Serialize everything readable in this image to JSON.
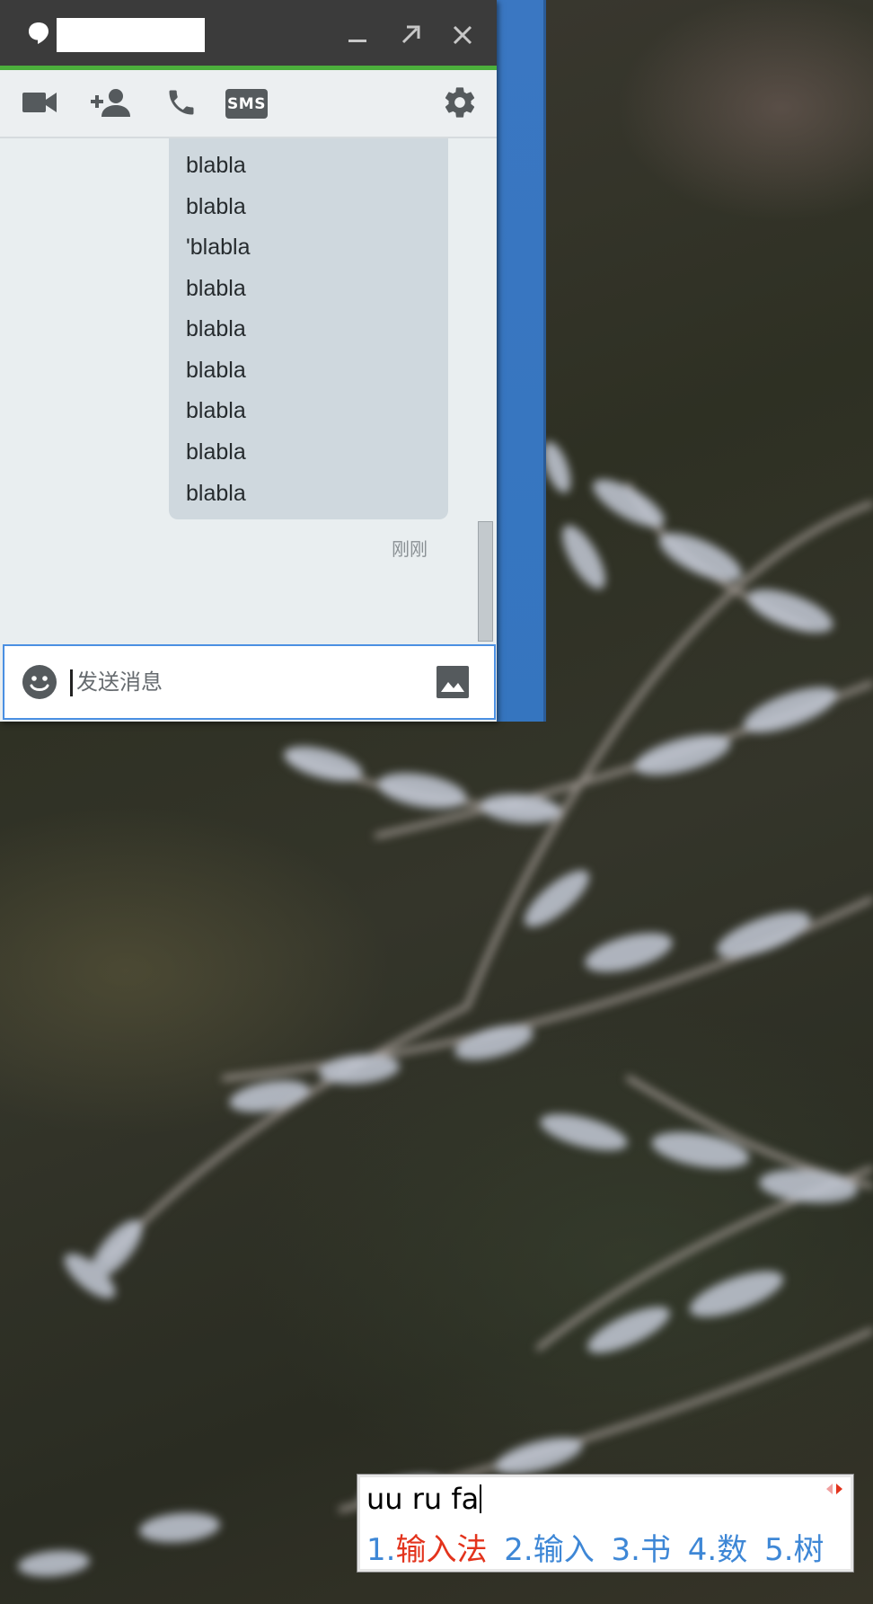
{
  "window": {
    "title_name": "",
    "minimize_icon": "minimize-icon",
    "popout_icon": "popout-icon",
    "close_icon": "close-icon"
  },
  "toolbar": {
    "video_icon": "video-call-icon",
    "add_user_icon": "add-person-icon",
    "call_icon": "phone-icon",
    "sms_label": "SMS",
    "settings_icon": "gear-icon"
  },
  "messages": {
    "lines": [
      "blabla",
      "blabla",
      "'blabla",
      "blabla",
      "blabla",
      "blabla",
      "blabla",
      "blabla",
      "blabla"
    ],
    "timestamp": "刚刚"
  },
  "input": {
    "placeholder": "发送消息",
    "value": "",
    "emoji_icon": "smiley-icon",
    "image_icon": "image-icon"
  },
  "ime": {
    "preedit": "uu ru fa",
    "candidates": [
      {
        "index": "1.",
        "text": "输入法",
        "selected": true
      },
      {
        "index": "2.",
        "text": "输入",
        "selected": false
      },
      {
        "index": "3.",
        "text": "书",
        "selected": false
      },
      {
        "index": "4.",
        "text": "数",
        "selected": false
      },
      {
        "index": "5.",
        "text": "树",
        "selected": false
      }
    ]
  },
  "colors": {
    "titlebar": "#3b3b3b",
    "accent_green": "#4caf3c",
    "bubble": "#cfd8de",
    "focus_blue": "#4a8fe2",
    "ime_selected": "#e3331c",
    "ime_candidate": "#3e87d6"
  }
}
